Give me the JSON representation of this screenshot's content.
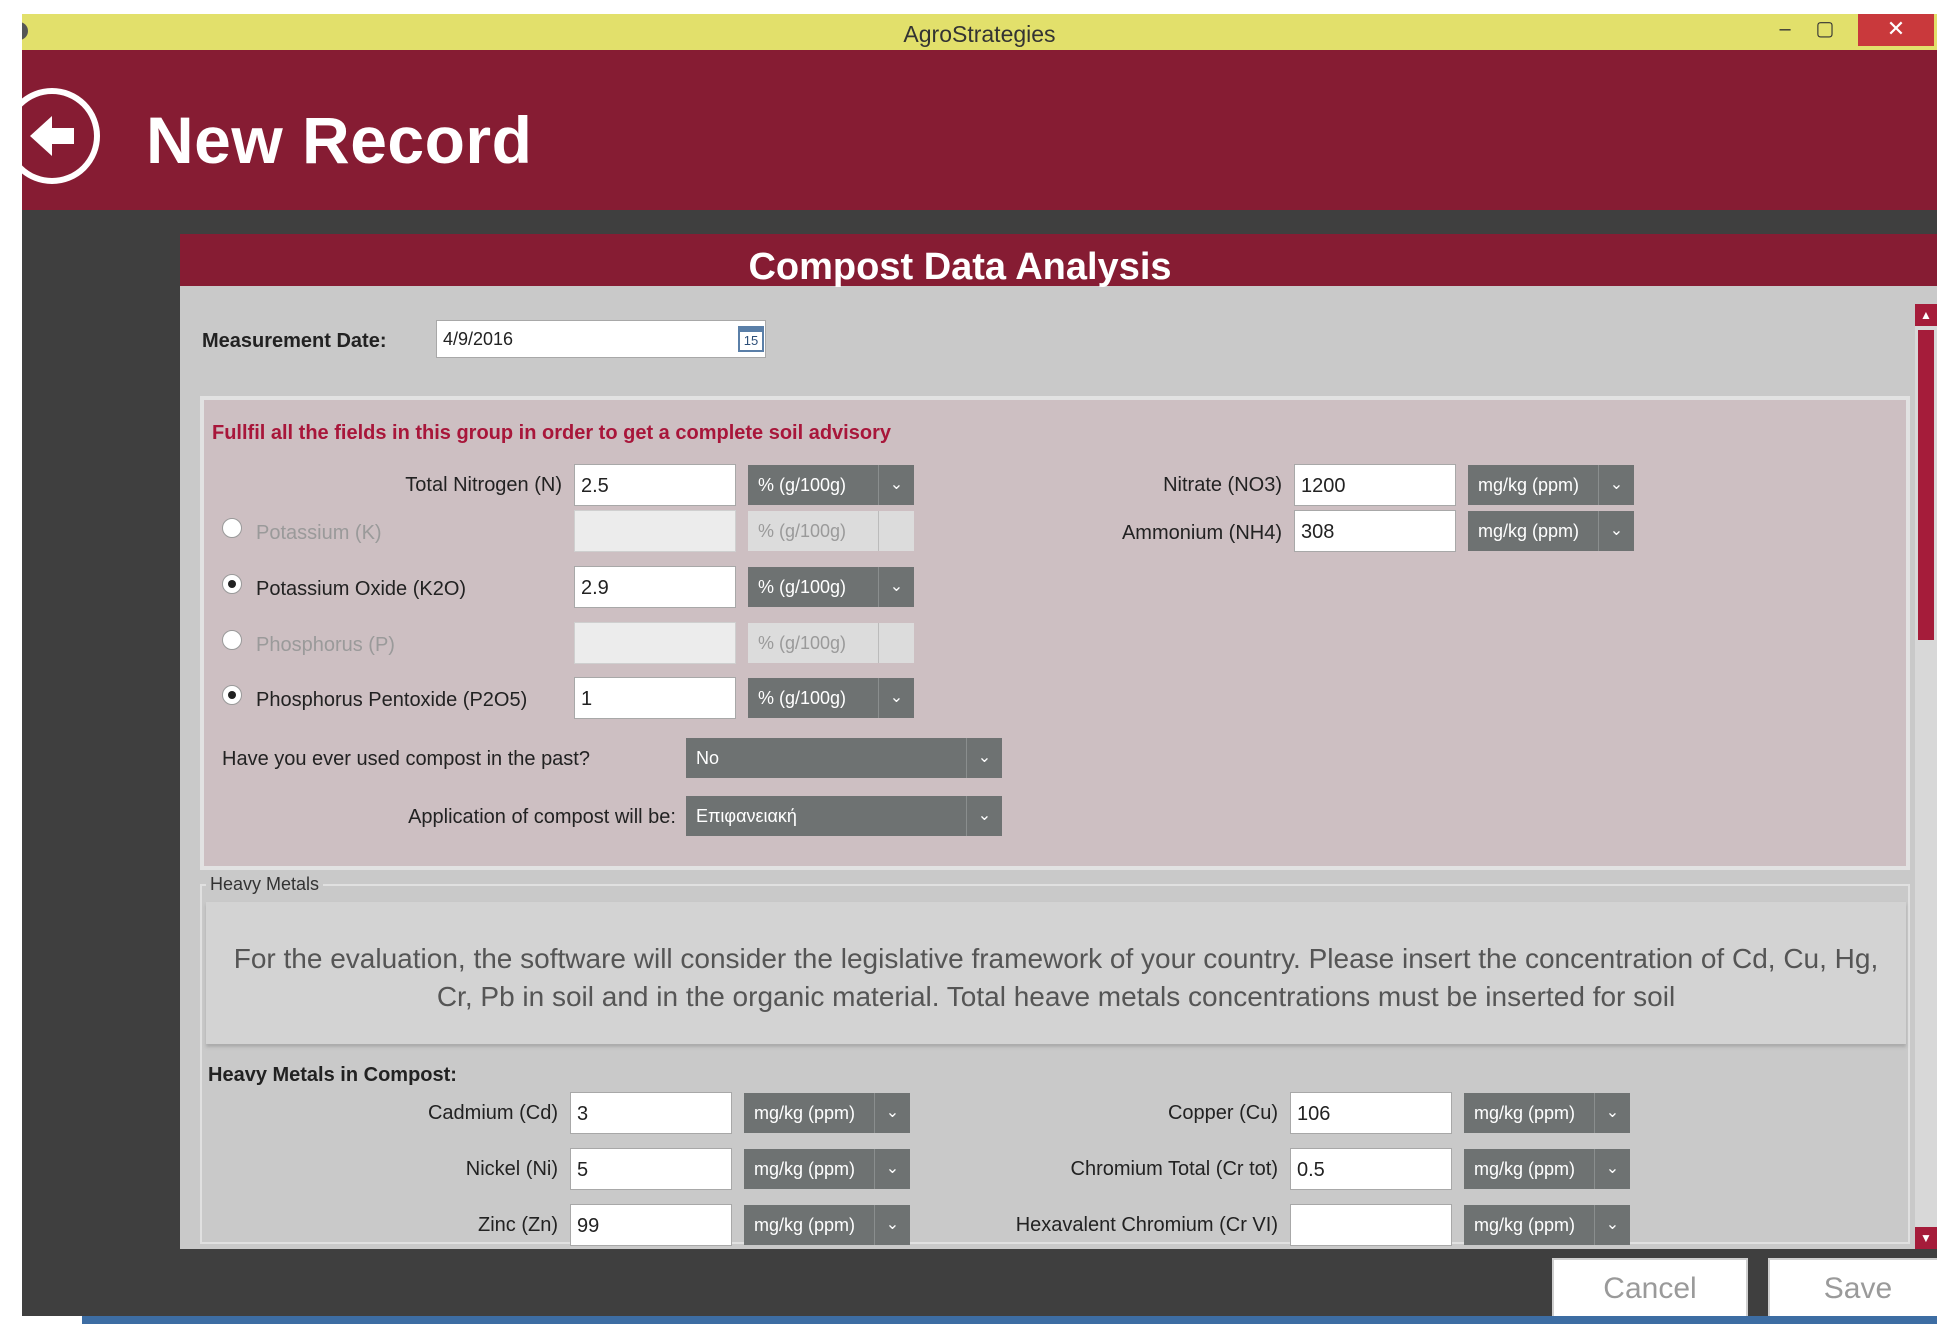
{
  "window": {
    "title": "AgroStrategies",
    "minimize": "–",
    "maximize": "▢",
    "close": "✕"
  },
  "header": {
    "title": "New Record"
  },
  "panel": {
    "title": "Compost Data Analysis"
  },
  "measurement": {
    "label": "Measurement Date:",
    "value": "4/9/2016",
    "calendar_day": "15"
  },
  "group": {
    "warning": "Fullfil all the fields in this group in order to get a complete soil advisory",
    "fields": {
      "nitrogen": {
        "label": "Total Nitrogen (N)",
        "value": "2.5",
        "unit": "% (g/100g)"
      },
      "potassium": {
        "label": "Potassium (K)",
        "value": "",
        "unit": "% (g/100g)",
        "selected": false
      },
      "potassium_oxide": {
        "label": "Potassium Oxide (K2O)",
        "value": "2.9",
        "unit": "% (g/100g)",
        "selected": true
      },
      "phosphorus": {
        "label": "Phosphorus (P)",
        "value": "",
        "unit": "% (g/100g)",
        "selected": false
      },
      "phosphorus_pentoxide": {
        "label": "Phosphorus Pentoxide (P2O5)",
        "value": "1",
        "unit": "% (g/100g)",
        "selected": true
      },
      "nitrate": {
        "label": "Nitrate (NO3)",
        "value": "1200",
        "unit": "mg/kg (ppm)"
      },
      "ammonium": {
        "label": "Ammonium (NH4)",
        "value": "308",
        "unit": "mg/kg (ppm)"
      }
    },
    "compost_past": {
      "label": "Have you ever used compost in the past?",
      "value": "No"
    },
    "application": {
      "label": "Application of compost will be:",
      "value": "Επιφανειακή"
    }
  },
  "heavy_metals": {
    "legend": "Heavy Metals",
    "info": "For the evaluation, the software will consider the legislative framework of your country. Please insert the concentration of Cd, Cu, Hg, Cr, Pb in soil and in the organic material. Total heave metals concentrations must be inserted for soil",
    "compost_heading": "Heavy Metals in Compost:",
    "fields": {
      "cadmium": {
        "label": "Cadmium (Cd)",
        "value": "3",
        "unit": "mg/kg (ppm)"
      },
      "nickel": {
        "label": "Nickel (Ni)",
        "value": "5",
        "unit": "mg/kg (ppm)"
      },
      "zinc": {
        "label": "Zinc (Zn)",
        "value": "99",
        "unit": "mg/kg (ppm)"
      },
      "copper": {
        "label": "Copper (Cu)",
        "value": "106",
        "unit": "mg/kg (ppm)"
      },
      "chromium_total": {
        "label": "Chromium Total (Cr tot)",
        "value": "0.5",
        "unit": "mg/kg (ppm)"
      },
      "chromium_vi": {
        "label": "Hexavalent Chromium (Cr VI)",
        "value": "",
        "unit": "mg/kg (ppm)"
      }
    }
  },
  "footer": {
    "cancel": "Cancel",
    "save": "Save"
  },
  "colors": {
    "titlebar": "#e2e06b",
    "brand": "#861c33",
    "close": "#c9393c",
    "select": "#6e7272"
  },
  "icons": {
    "back": "arrow-left-circle-icon",
    "calendar": "calendar-icon",
    "dropdown": "chevron-down-icon"
  }
}
